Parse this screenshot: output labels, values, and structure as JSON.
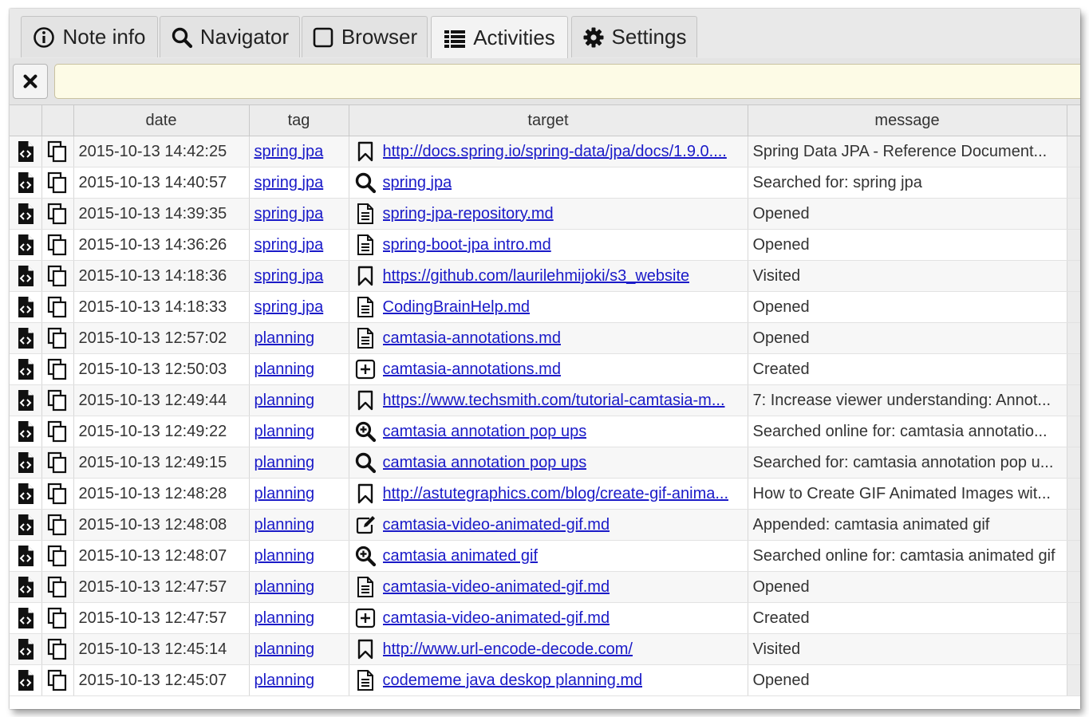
{
  "tabs": [
    {
      "label": "Note info",
      "icon": "info-icon"
    },
    {
      "label": "Navigator",
      "icon": "search-icon"
    },
    {
      "label": "Browser",
      "icon": "square-icon"
    },
    {
      "label": "Activities",
      "icon": "list-icon"
    },
    {
      "label": "Settings",
      "icon": "gear-icon"
    }
  ],
  "active_tab": "Activities",
  "filter": {
    "value": "",
    "placeholder": ""
  },
  "columns": [
    "date",
    "tag",
    "target",
    "message"
  ],
  "rows": [
    {
      "date": "2015-10-13 14:42:25",
      "tag": "spring jpa",
      "icon": "bookmark-icon",
      "target": "http://docs.spring.io/spring-data/jpa/docs/1.9.0....",
      "message": "Spring Data JPA - Reference Document..."
    },
    {
      "date": "2015-10-13 14:40:57",
      "tag": "spring jpa",
      "icon": "search-icon",
      "target": "spring jpa",
      "message": "Searched for: spring jpa"
    },
    {
      "date": "2015-10-13 14:39:35",
      "tag": "spring jpa",
      "icon": "document-icon",
      "target": "spring-jpa-repository.md",
      "message": "Opened"
    },
    {
      "date": "2015-10-13 14:36:26",
      "tag": "spring jpa",
      "icon": "document-icon",
      "target": "spring-boot-jpa intro.md",
      "message": "Opened"
    },
    {
      "date": "2015-10-13 14:18:36",
      "tag": "spring jpa",
      "icon": "bookmark-icon",
      "target": "https://github.com/laurilehmijoki/s3_website",
      "message": "Visited"
    },
    {
      "date": "2015-10-13 14:18:33",
      "tag": "spring jpa",
      "icon": "document-icon",
      "target": "CodingBrainHelp.md",
      "message": "Opened"
    },
    {
      "date": "2015-10-13 12:57:02",
      "tag": "planning",
      "icon": "document-icon",
      "target": "camtasia-annotations.md",
      "message": "Opened"
    },
    {
      "date": "2015-10-13 12:50:03",
      "tag": "planning",
      "icon": "plus-square-icon",
      "target": "camtasia-annotations.md",
      "message": "Created"
    },
    {
      "date": "2015-10-13 12:49:44",
      "tag": "planning",
      "icon": "bookmark-icon",
      "target": "https://www.techsmith.com/tutorial-camtasia-m...",
      "message": "7: Increase viewer understanding: Annot..."
    },
    {
      "date": "2015-10-13 12:49:22",
      "tag": "planning",
      "icon": "zoom-in-icon",
      "target": "camtasia annotation pop ups",
      "message": "Searched online for: camtasia annotatio..."
    },
    {
      "date": "2015-10-13 12:49:15",
      "tag": "planning",
      "icon": "search-icon",
      "target": "camtasia annotation pop ups",
      "message": "Searched for: camtasia annotation pop u..."
    },
    {
      "date": "2015-10-13 12:48:28",
      "tag": "planning",
      "icon": "bookmark-icon",
      "target": "http://astutegraphics.com/blog/create-gif-anima...",
      "message": "How to Create GIF Animated Images wit..."
    },
    {
      "date": "2015-10-13 12:48:08",
      "tag": "planning",
      "icon": "edit-icon",
      "target": "camtasia-video-animated-gif.md",
      "message": "Appended: camtasia animated gif"
    },
    {
      "date": "2015-10-13 12:48:07",
      "tag": "planning",
      "icon": "zoom-in-icon",
      "target": "camtasia animated gif",
      "message": "Searched online for: camtasia animated gif"
    },
    {
      "date": "2015-10-13 12:47:57",
      "tag": "planning",
      "icon": "document-icon",
      "target": "camtasia-video-animated-gif.md",
      "message": "Opened"
    },
    {
      "date": "2015-10-13 12:47:57",
      "tag": "planning",
      "icon": "plus-square-icon",
      "target": "camtasia-video-animated-gif.md",
      "message": "Created"
    },
    {
      "date": "2015-10-13 12:45:14",
      "tag": "planning",
      "icon": "bookmark-icon",
      "target": "http://www.url-encode-decode.com/",
      "message": "Visited"
    },
    {
      "date": "2015-10-13 12:45:07",
      "tag": "planning",
      "icon": "document-icon",
      "target": "codememe java deskop planning.md",
      "message": "Opened"
    }
  ]
}
